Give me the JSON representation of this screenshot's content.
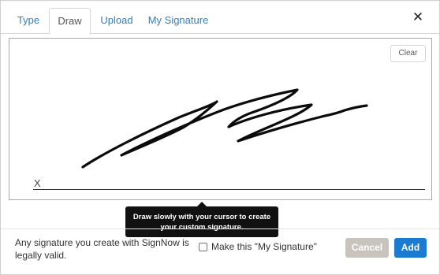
{
  "tabs": [
    {
      "label": "Type",
      "active": false
    },
    {
      "label": "Draw",
      "active": true
    },
    {
      "label": "Upload",
      "active": false
    },
    {
      "label": "My Signature",
      "active": false
    }
  ],
  "close_icon": "close-icon",
  "canvas": {
    "clear_label": "Clear",
    "x_label": "X"
  },
  "tooltip": {
    "line1": "Draw slowly with your cursor to create",
    "line2": "your custom signature."
  },
  "footer": {
    "legal_text": "Any signature you create with SignNow is legally valid.",
    "checkbox_label": "Make this \"My Signature\"",
    "checkbox_checked": false,
    "cancel_label": "Cancel",
    "add_label": "Add"
  },
  "colors": {
    "link": "#2f7fc1",
    "add_button": "#1a7bd0",
    "cancel_button": "#c9c3be",
    "tooltip_bg": "#111111"
  }
}
